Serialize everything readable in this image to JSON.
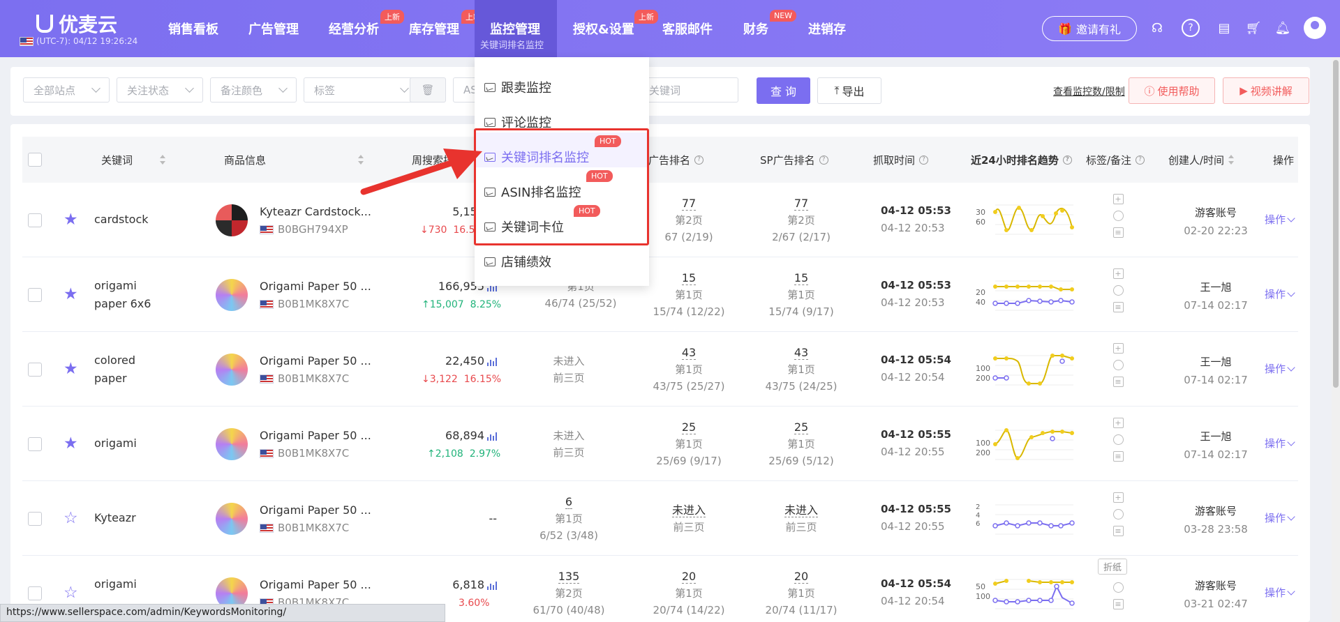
{
  "header": {
    "logo_text": "优麦云",
    "clock": "(UTC-7): 04/12 19:26:24",
    "nav": [
      {
        "label": "销售看板",
        "badge": ""
      },
      {
        "label": "广告管理",
        "badge": ""
      },
      {
        "label": "经营分析",
        "badge": "上新"
      },
      {
        "label": "库存管理",
        "badge": "上新"
      },
      {
        "label": "监控管理",
        "badge": "上新"
      },
      {
        "label": "授权&设置",
        "badge": "上新"
      },
      {
        "label": "客服邮件",
        "badge": ""
      },
      {
        "label": "财务",
        "badge": "NEW"
      },
      {
        "label": "进销存",
        "badge": ""
      }
    ],
    "active_sub": "关键词排名监控",
    "invite_label": "邀请有礼",
    "accent_color": "#7b6ef0",
    "icons": [
      "headset-icon",
      "help-icon",
      "message-icon",
      "cart-icon",
      "bell-icon",
      "avatar-icon"
    ]
  },
  "filters": {
    "site": "全部站点",
    "follow": "关注状态",
    "color": "备注颜色",
    "tag": "标签",
    "asin_prefix": "AS",
    "keyword_placeholder": "关键词",
    "query": "查 询",
    "export": "导出",
    "view_limit": "查看监控数/限制",
    "help": "使用帮助",
    "video": "视频讲解"
  },
  "dropdown": {
    "items": [
      {
        "label": "跟卖监控",
        "hot": ""
      },
      {
        "label": "评论监控",
        "hot": ""
      },
      {
        "label": "关键词排名监控",
        "hot": "HOT"
      },
      {
        "label": "ASIN排名监控",
        "hot": "HOT"
      },
      {
        "label": "关键词卡位",
        "hot": "HOT"
      },
      {
        "label": "店铺绩效",
        "hot": ""
      }
    ]
  },
  "table": {
    "headers": {
      "keyword": "关键词",
      "product": "商品信息",
      "weekly": "周搜索排名",
      "ad": "广告排名",
      "sp": "SP广告排名",
      "fetch": "抓取时间",
      "trend": "近24小时排名趋势",
      "tag": "标签/备注",
      "creator": "创建人/时间",
      "op": "操作"
    },
    "rows": [
      {
        "keyword": [
          "cardstock"
        ],
        "starred": true,
        "product": "Kyteazr Cardstock...",
        "asin": "B0BGH794XP",
        "volume": "5,154",
        "change": "↓730",
        "change_dir": "down",
        "pct": "16.50",
        "nat": {
          "n": "",
          "p": "",
          "t": ""
        },
        "ad": {
          "n": "77",
          "p": "第2页",
          "t": "2/67 (2/19)",
          "clip": "67 (2/19)"
        },
        "sp": {
          "n": "77",
          "p": "第2页",
          "t": "2/67  (2/17)"
        },
        "fetch": [
          "04-12 05:53",
          "04-12 20:53"
        ],
        "trend_labels": [
          "30",
          "60"
        ],
        "creator": "游客账号",
        "created": "02-20 22:23",
        "op": "操作"
      },
      {
        "keyword": [
          "origami",
          "paper 6x6"
        ],
        "starred": true,
        "product": "Origami Paper 50 ...",
        "asin": "B0B1MK8X7C",
        "volume": "166,955",
        "change": "↑15,007",
        "change_dir": "up",
        "pct": "8.25%",
        "nat": {
          "n": "",
          "p": "第1页",
          "t": "46/74  (25/52)"
        },
        "ad": {
          "n": "15",
          "p": "第1页",
          "t": "15/74  (12/22)"
        },
        "sp": {
          "n": "15",
          "p": "第1页",
          "t": "15/74  (9/17)"
        },
        "fetch": [
          "04-12 05:53",
          "04-12 20:53"
        ],
        "trend_labels": [
          "20",
          "40"
        ],
        "creator": "王一旭",
        "created": "07-14 02:17",
        "op": "操作"
      },
      {
        "keyword": [
          "colored",
          "paper"
        ],
        "starred": true,
        "product": "Origami Paper 50 ...",
        "asin": "B0B1MK8X7C",
        "volume": "22,450",
        "change": "↓3,122",
        "change_dir": "down",
        "pct": "16.15%",
        "nat": {
          "n": "",
          "p": "未进入",
          "t": "前三页"
        },
        "ad": {
          "n": "43",
          "p": "第1页",
          "t": "43/75  (25/27)"
        },
        "sp": {
          "n": "43",
          "p": "第1页",
          "t": "43/75  (24/25)"
        },
        "fetch": [
          "04-12 05:54",
          "04-12 20:54"
        ],
        "trend_labels": [
          "100",
          "200"
        ],
        "creator": "王一旭",
        "created": "07-14 02:17",
        "op": "操作"
      },
      {
        "keyword": [
          "origami"
        ],
        "starred": true,
        "product": "Origami Paper 50 ...",
        "asin": "B0B1MK8X7C",
        "volume": "68,894",
        "change": "↑2,108",
        "change_dir": "up",
        "pct": "2.97%",
        "nat": {
          "n": "",
          "p": "未进入",
          "t": "前三页"
        },
        "ad": {
          "n": "25",
          "p": "第1页",
          "t": "25/69  (9/17)"
        },
        "sp": {
          "n": "25",
          "p": "第1页",
          "t": "25/69  (5/12)"
        },
        "fetch": [
          "04-12 05:55",
          "04-12 20:55"
        ],
        "trend_labels": [
          "100",
          "200"
        ],
        "creator": "王一旭",
        "created": "07-14 02:17",
        "op": "操作"
      },
      {
        "keyword": [
          "Kyteazr"
        ],
        "starred": false,
        "product": "Origami Paper 50 ...",
        "asin": "B0B1MK8X7C",
        "volume": "--",
        "change": "",
        "change_dir": "",
        "pct": "",
        "nat": {
          "n": "6",
          "p": "第1页",
          "t": "6/52  (3/48)"
        },
        "ad": {
          "n": "",
          "p": "未进入",
          "t": "前三页"
        },
        "sp": {
          "n": "",
          "p": "未进入",
          "t": "前三页"
        },
        "fetch": [
          "04-12 05:55",
          "04-12 20:55"
        ],
        "trend_labels": [
          "2",
          "4",
          "6"
        ],
        "creator": "游客账号",
        "created": "03-28 23:58",
        "op": "操作"
      },
      {
        "keyword": [
          "origami"
        ],
        "starred": false,
        "product": "Origami Paper 50 ...",
        "asin": "B0B1MK8X7C",
        "volume": "6,818",
        "change": "",
        "change_dir": "down",
        "pct": "3.60%",
        "nat": {
          "n": "135",
          "p": "第2页",
          "t": "61/70  (40/48)"
        },
        "ad": {
          "n": "20",
          "p": "第1页",
          "t": "20/74  (14/22)"
        },
        "sp": {
          "n": "20",
          "p": "第1页",
          "t": "20/74  (11/17)"
        },
        "fetch": [
          "04-12 05:54",
          "04-12 20:54"
        ],
        "trend_labels": [
          "50",
          "100"
        ],
        "creator": "游客账号",
        "created": "03-21 02:47",
        "op": "操作",
        "tag_button": "折纸"
      }
    ]
  },
  "status_url": "https://www.sellerspace.com/admin/KeywordsMonitoring/"
}
